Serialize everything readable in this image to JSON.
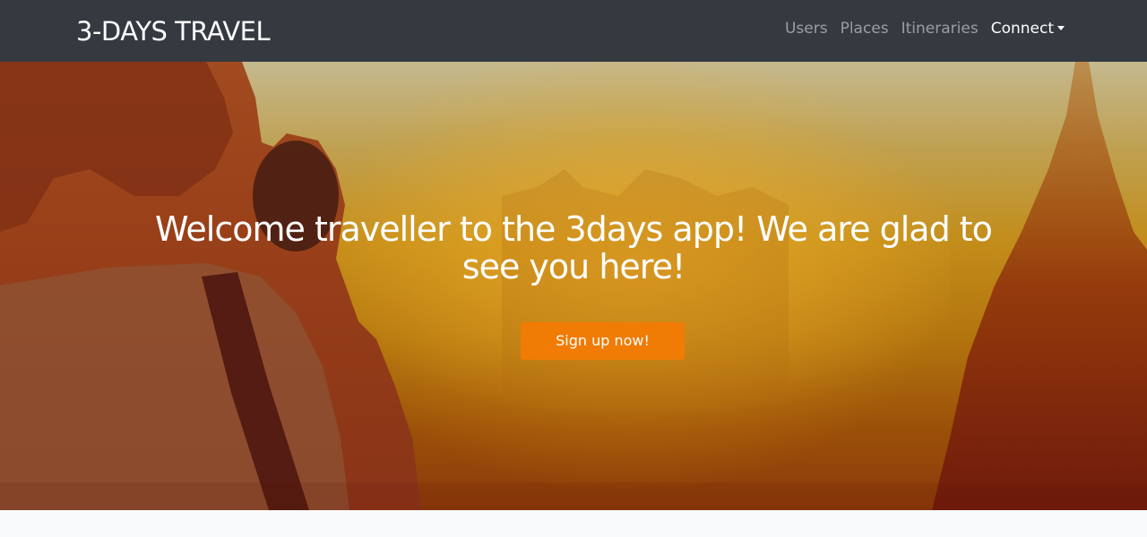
{
  "navbar": {
    "brand": "3-DAYS TRAVEL",
    "links": [
      "Users",
      "Places",
      "Itineraries"
    ],
    "connect": "Connect",
    "background": "#343a40"
  },
  "hero": {
    "title": "Welcome traveller to the 3days app! We are glad to see you here!",
    "cta_label": "Sign up now!",
    "cta_color": "#f07b05",
    "background_image": "traveller taking photo at sunset with temple silhouette"
  }
}
